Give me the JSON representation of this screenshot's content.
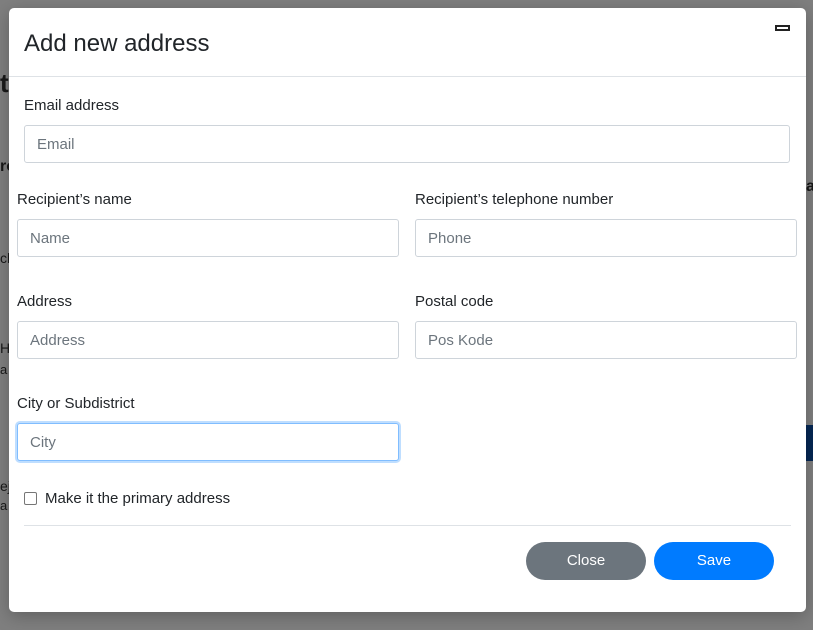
{
  "background": {
    "fragments": [
      "t",
      "ro",
      "ch",
      "H",
      "a",
      "ej",
      "a",
      "a"
    ]
  },
  "modal": {
    "title": "Add new address",
    "minimize_icon": "minimize-icon"
  },
  "form": {
    "email": {
      "label": "Email address",
      "placeholder": "Email",
      "value": ""
    },
    "name": {
      "label": "Recipient’s name",
      "placeholder": "Name",
      "value": ""
    },
    "phone": {
      "label": "Recipient’s telephone number",
      "placeholder": "Phone",
      "value": ""
    },
    "address": {
      "label": "Address",
      "placeholder": "Address",
      "value": ""
    },
    "postal": {
      "label": "Postal code",
      "placeholder": "Pos Kode",
      "value": ""
    },
    "city": {
      "label": "City or Subdistrict",
      "placeholder": "City",
      "value": "",
      "focused": true
    },
    "primary": {
      "label": "Make it the primary address",
      "checked": false
    }
  },
  "footer": {
    "close_label": "Close",
    "save_label": "Save"
  },
  "colors": {
    "primary": "#007bff",
    "secondary": "#6c757d",
    "focus_border": "#80bdff"
  }
}
